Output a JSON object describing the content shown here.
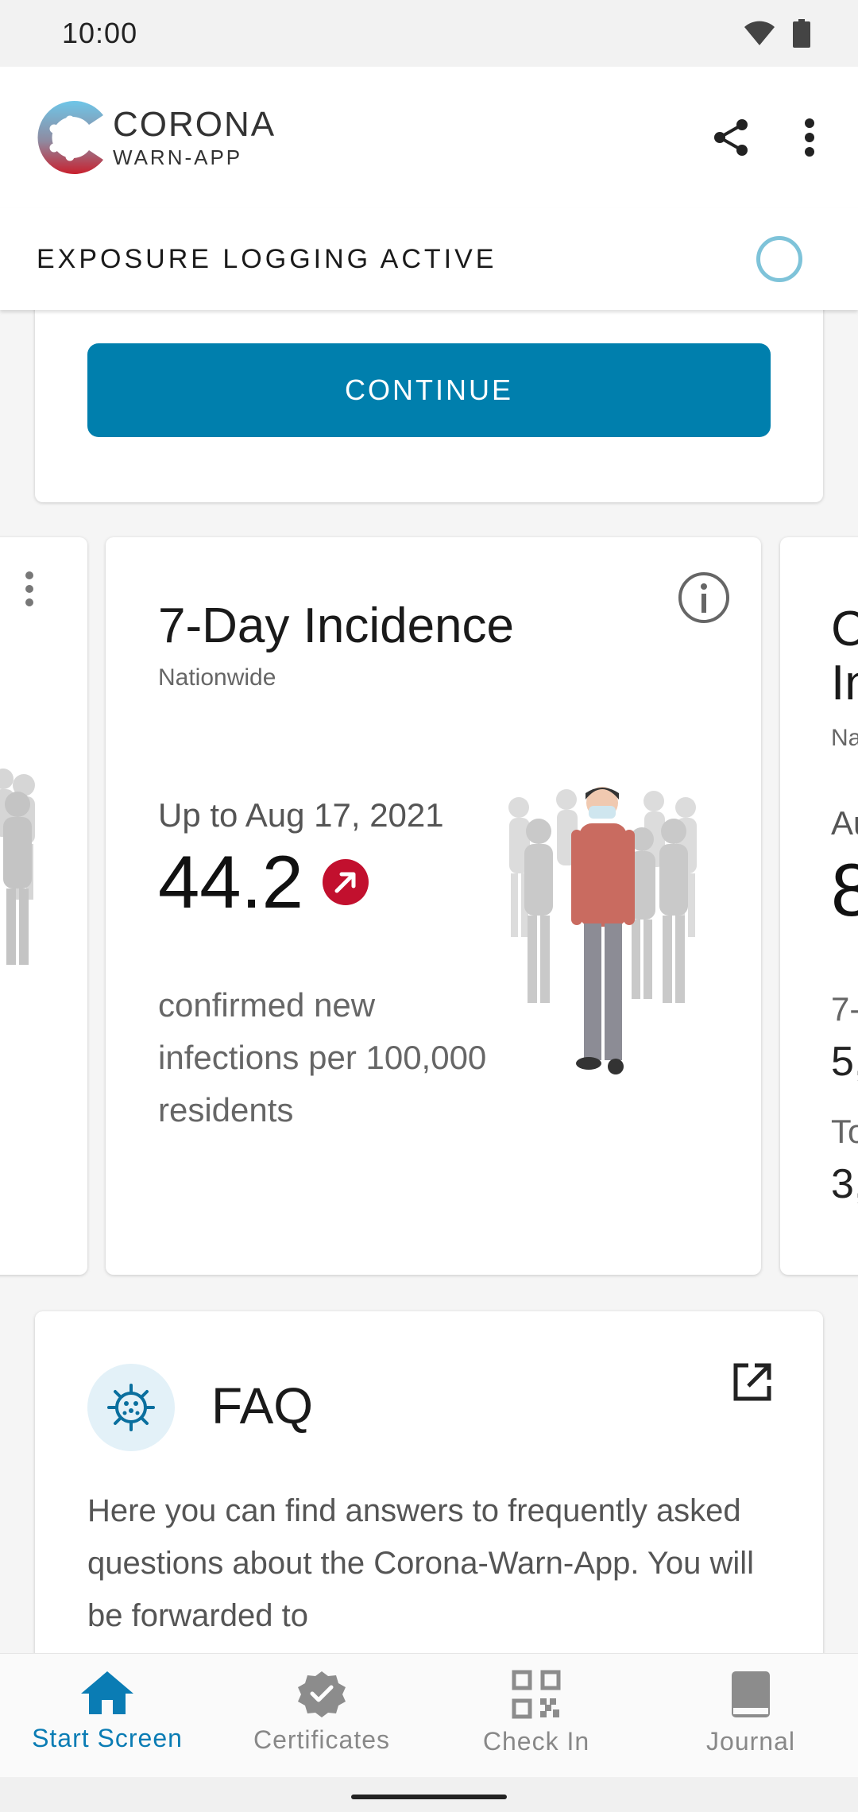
{
  "status_bar": {
    "time": "10:00"
  },
  "app_bar": {
    "logo_title": "CORONA",
    "logo_subtitle": "WARN-APP"
  },
  "exposure": {
    "label": "EXPOSURE LOGGING ACTIVE"
  },
  "top_card": {
    "continue_label": "CONTINUE"
  },
  "incidence_card": {
    "title": "7-Day Incidence",
    "subtitle": "Nationwide",
    "date": "Up to Aug 17, 2021",
    "value": "44.2",
    "trend": "increasing",
    "description": "confirmed new infections per 100,000 residents"
  },
  "right_peek": {
    "title_line1": "C",
    "title_line2": "In",
    "subtitle": "Na",
    "date": "Au",
    "value": "8",
    "label1": "7-",
    "value1": "5,",
    "label2": "To",
    "value2": "3,"
  },
  "faq": {
    "title": "FAQ",
    "text": "Here you can find answers to frequently asked questions about the Corona-Warn-App. You will be forwarded to"
  },
  "bottom_nav": {
    "items": [
      {
        "label": "Start Screen",
        "icon": "home-icon",
        "active": true
      },
      {
        "label": "Certificates",
        "icon": "certificate-icon",
        "active": false
      },
      {
        "label": "Check In",
        "icon": "qr-code-icon",
        "active": false
      },
      {
        "label": "Journal",
        "icon": "journal-icon",
        "active": false
      }
    ]
  },
  "colors": {
    "primary": "#007fad",
    "trend_up": "#c2102e",
    "active_nav": "#0a7cb4"
  }
}
